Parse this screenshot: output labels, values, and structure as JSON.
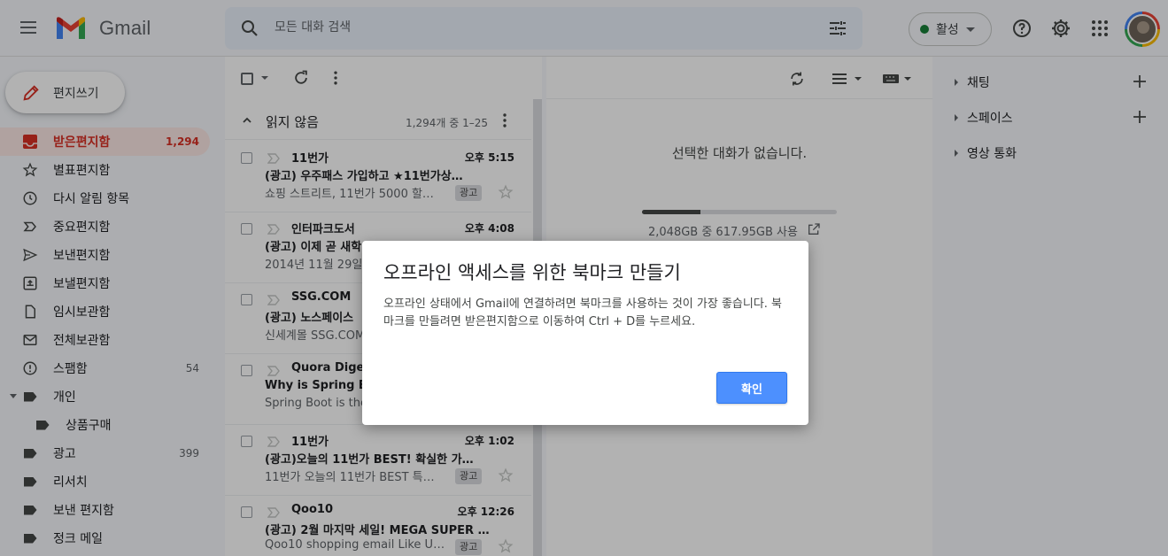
{
  "header": {
    "app_name": "Gmail",
    "search_placeholder": "모든 대화 검색",
    "status_label": "활성"
  },
  "sidebar": {
    "compose_label": "편지쓰기",
    "items": [
      {
        "label": "받은편지함",
        "count": "1,294"
      },
      {
        "label": "별표편지함",
        "count": ""
      },
      {
        "label": "다시 알림 항목",
        "count": ""
      },
      {
        "label": "중요편지함",
        "count": ""
      },
      {
        "label": "보낸편지함",
        "count": ""
      },
      {
        "label": "보낼편지함",
        "count": ""
      },
      {
        "label": "임시보관함",
        "count": ""
      },
      {
        "label": "전체보관함",
        "count": ""
      },
      {
        "label": "스팸함",
        "count": "54"
      },
      {
        "label": "개인",
        "count": ""
      },
      {
        "label": "상품구매",
        "count": ""
      },
      {
        "label": "광고",
        "count": "399"
      },
      {
        "label": "리서치",
        "count": ""
      },
      {
        "label": "보낸 편지함",
        "count": ""
      },
      {
        "label": "정크 메일",
        "count": ""
      }
    ]
  },
  "mail_list": {
    "section_title": "읽지 않음",
    "range": "1,294개 중 1–25",
    "rows": [
      {
        "sender": "11번가",
        "time": "오후 5:15",
        "subject": "(광고) 우주패스 가입하고 ★11번가상…",
        "snippet": "쇼핑 스트리트, 11번가 5000 할…",
        "badge": "광고"
      },
      {
        "sender": "인터파크도서",
        "time": "오후 4:08",
        "subject": "(광고) 이제 곧 새학",
        "snippet": "2014년 11월 29일 ",
        "badge": ""
      },
      {
        "sender": "SSG.COM",
        "time": "",
        "subject": "(광고) 노스페이스",
        "snippet": "신세계몰 SSG.COM",
        "badge": ""
      },
      {
        "sender": "Quora Digest",
        "time": "",
        "subject": "Why is Spring Boot",
        "snippet": "Spring Boot is the",
        "badge": ""
      },
      {
        "sender": "11번가",
        "time": "오후 1:02",
        "subject": "(광고)오늘의 11번가 BEST! 확실한 가…",
        "snippet": "11번가 오늘의 11번가 BEST 특…",
        "badge": "광고"
      },
      {
        "sender": "Qoo10",
        "time": "오후 12:26",
        "subject": "(광고) 2월 마지막 세일! MEGA SUPER …",
        "snippet": "Qoo10 shopping email Like Us …",
        "badge": "광고"
      }
    ]
  },
  "reading_pane": {
    "empty_message": "선택한 대화가 없습니다.",
    "storage_text": "2,048GB 중 617.95GB 사용",
    "storage_used_fraction": 0.3
  },
  "right_panel": {
    "sections": [
      "채팅",
      "스페이스",
      "영상 통화"
    ]
  },
  "dialog": {
    "title": "오프라인 액세스를 위한 북마크 만들기",
    "body": "오프라인 상태에서 Gmail에 연결하려면 북마크를 사용하는 것이 가장 좋습니다. 북마크를 만들려면 받은편지함으로 이동하여 Ctrl + D를 누르세요.",
    "confirm_label": "확인"
  },
  "colors": {
    "accent": "#4d90fe",
    "inbox_active": "#d93025",
    "online": "#188038"
  }
}
